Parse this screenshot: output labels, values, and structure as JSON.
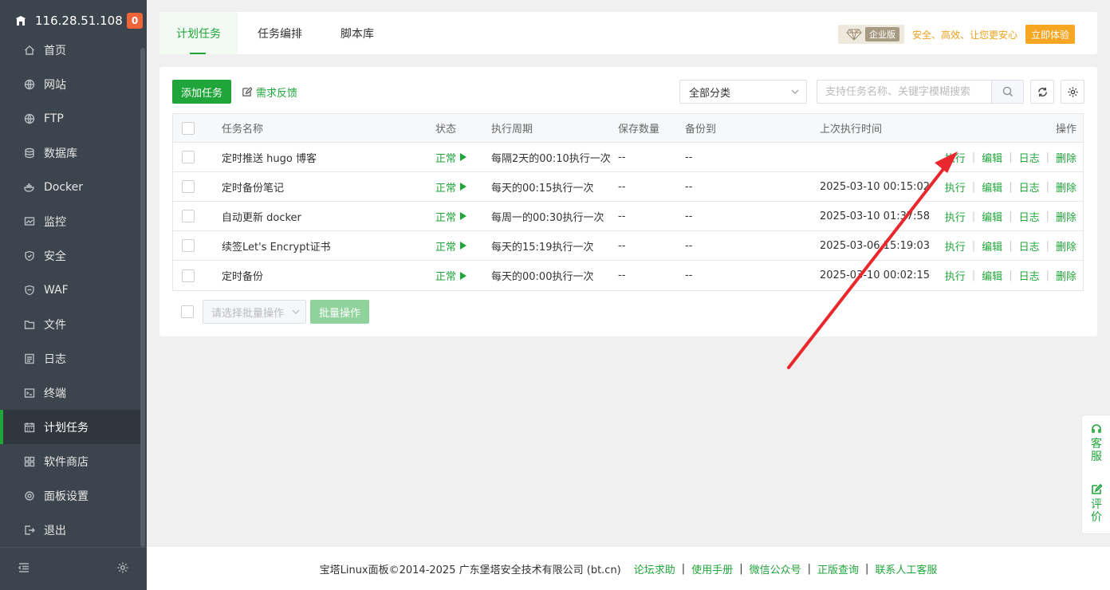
{
  "sidebar": {
    "ip": "116.28.51.108",
    "badge": "0",
    "items": [
      {
        "label": "首页",
        "icon": "home-icon"
      },
      {
        "label": "网站",
        "icon": "globe-icon"
      },
      {
        "label": "FTP",
        "icon": "ftp-globe-icon"
      },
      {
        "label": "数据库",
        "icon": "database-icon"
      },
      {
        "label": "Docker",
        "icon": "docker-icon"
      },
      {
        "label": "监控",
        "icon": "monitor-icon"
      },
      {
        "label": "安全",
        "icon": "shield-icon"
      },
      {
        "label": "WAF",
        "icon": "waf-shield-icon"
      },
      {
        "label": "文件",
        "icon": "folder-icon"
      },
      {
        "label": "日志",
        "icon": "log-icon"
      },
      {
        "label": "终端",
        "icon": "terminal-icon"
      },
      {
        "label": "计划任务",
        "icon": "calendar-icon",
        "active": true
      },
      {
        "label": "软件商店",
        "icon": "grid-icon"
      },
      {
        "label": "面板设置",
        "icon": "gear-icon"
      },
      {
        "label": "退出",
        "icon": "logout-icon"
      }
    ]
  },
  "tabs": [
    "计划任务",
    "任务编排",
    "脚本库"
  ],
  "enterprise": {
    "tag": "企业版",
    "slogan": "安全、高效、让您更安心",
    "button": "立即体验"
  },
  "toolbar": {
    "add_button": "添加任务",
    "feedback": "需求反馈",
    "category": "全部分类",
    "search_placeholder": "支持任务名称、关键字模糊搜索"
  },
  "table": {
    "headers": {
      "name": "任务名称",
      "status": "状态",
      "cycle": "执行周期",
      "keep": "保存数量",
      "backup": "备份到",
      "last": "上次执行时间",
      "ops": "操作"
    },
    "rows": [
      {
        "name": "定时推送 hugo 博客",
        "status": "正常",
        "cycle": "每隔2天的00:10执行一次",
        "keep": "--",
        "backup": "--",
        "last": ""
      },
      {
        "name": "定时备份笔记",
        "status": "正常",
        "cycle": "每天的00:15执行一次",
        "keep": "--",
        "backup": "--",
        "last": "2025-03-10 00:15:02"
      },
      {
        "name": "自动更新 docker",
        "status": "正常",
        "cycle": "每周一的00:30执行一次",
        "keep": "--",
        "backup": "--",
        "last": "2025-03-10 01:37:58"
      },
      {
        "name": "续签Let's Encrypt证书",
        "status": "正常",
        "cycle": "每天的15:19执行一次",
        "keep": "--",
        "backup": "--",
        "last": "2025-03-06 15:19:03"
      },
      {
        "name": "定时备份",
        "status": "正常",
        "cycle": "每天的00:00执行一次",
        "keep": "--",
        "backup": "--",
        "last": "2025-03-10 00:02:15"
      }
    ],
    "ops": [
      "执行",
      "编辑",
      "日志",
      "删除"
    ]
  },
  "batch": {
    "select_placeholder": "请选择批量操作",
    "button": "批量操作"
  },
  "footer": {
    "copyright": "宝塔Linux面板©2014-2025 广东堡塔安全技术有限公司 (bt.cn)",
    "links": [
      "论坛求助",
      "使用手册",
      "微信公众号",
      "正版查询",
      "联系人工客服"
    ]
  },
  "float": {
    "service": "客服",
    "review": "评价"
  },
  "colors": {
    "accent": "#20a53a",
    "sidebar": "#3c444d",
    "arrow": "#e8282d",
    "gold": "#f5a623"
  }
}
